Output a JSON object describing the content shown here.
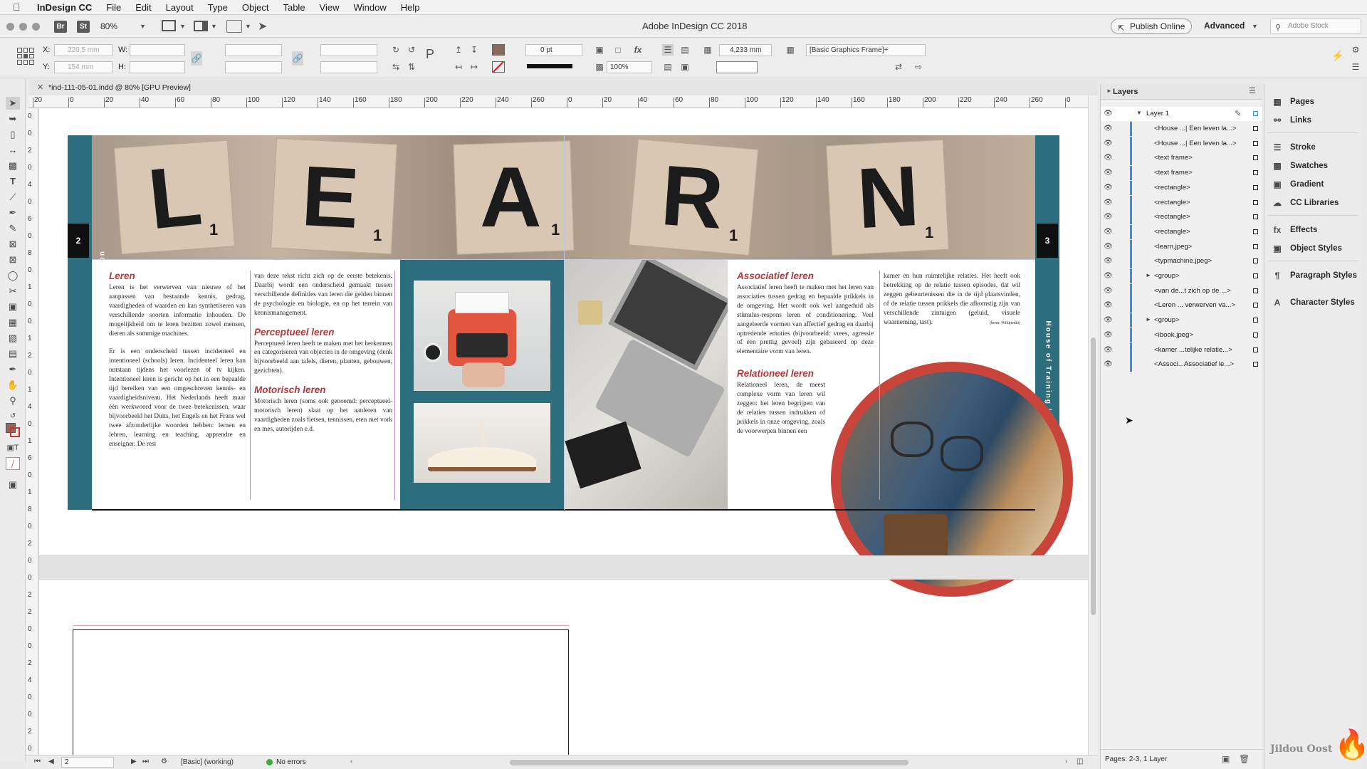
{
  "menubar": {
    "app": "InDesign CC",
    "items": [
      "File",
      "Edit",
      "Layout",
      "Type",
      "Object",
      "Table",
      "View",
      "Window",
      "Help"
    ]
  },
  "titlebar": {
    "title": "Adobe InDesign CC 2018",
    "zoom": "80%",
    "br_label": "Br",
    "st_label": "St",
    "publish": "Publish Online",
    "workspace": "Advanced",
    "search_placeholder": "Adobe Stock"
  },
  "control": {
    "x_label": "X:",
    "x_value": "220,5 mm",
    "y_label": "Y:",
    "y_value": "154 mm",
    "w_label": "W:",
    "h_label": "H:",
    "stroke_weight": "0 pt",
    "scale": "100%",
    "gap": "4,233 mm",
    "object_style": "[Basic Graphics Frame]+"
  },
  "doc_tab": {
    "title": "*ind-111-05-01.indd @ 80% [GPU Preview]"
  },
  "ruler": {
    "h_ticks": [
      "20",
      "0",
      "20",
      "40",
      "60",
      "80",
      "100",
      "120",
      "140",
      "160",
      "180",
      "200",
      "220",
      "240",
      "260",
      "0",
      "20",
      "40",
      "60",
      "80",
      "100",
      "120",
      "140",
      "160",
      "180",
      "200",
      "220",
      "240",
      "260",
      "0"
    ],
    "v_ticks": [
      "0",
      "0",
      "2",
      "0",
      "4",
      "0",
      "6",
      "0",
      "8",
      "0",
      "1",
      "0",
      "0",
      "1",
      "2",
      "0",
      "1",
      "4",
      "0",
      "1",
      "6",
      "0",
      "1",
      "8",
      "0",
      "2",
      "0",
      "0",
      "2",
      "2",
      "0",
      "0",
      "2",
      "4",
      "0",
      "0",
      "2",
      "0"
    ]
  },
  "spread": {
    "learn_letters": [
      "L",
      "E",
      "A",
      "R",
      "N"
    ],
    "learn_subs": [
      "1",
      "1",
      "1",
      "1",
      "1"
    ],
    "page_left": "2",
    "page_right": "3",
    "side_text": "House of Training | Een leven lang leren",
    "col1_head": "Leren",
    "col1_p1": "Leren is het verwerven van nieuwe of het aanpassen van bestaande kennis, gedrag, vaardigheden of waarden en kan synthetiseren van verschillende soorten informatie inhouden. De mogelijkheid om te leren bezitten zowel mensen, dieren als sommige machines.",
    "col1_p2": "Er is een onderscheid tussen incidenteel en intentioneel (schools) leren. Incidenteel leren kan ontstaan tijdens het voorlezen of tv kijken. Intentioneel leren is gericht op het in een bepaalde tijd bereiken van een omgeschreven kennis- en vaardigheidsniveau. Het Nederlands heeft maar één werkwoord voor de twee betekenissen, waar bijvoorbeeld het Duits, het Engels en het Frans wel twee afzonderlijke woorden hebben: lernen en lehren, learning en teaching, apprendre en enseigner. De rest",
    "col2_p1": "van deze tekst richt zich op de eerste betekenis. Daarbij wordt een onderscheid gemaakt tussen verschillende definities van leren die gelden binnen de psychologie en biologie, en op het terrein van kennismanagement.",
    "col2_head1": "Perceptueel leren",
    "col2_p2": "Perceptueel leren heeft te maken met het herkennen en categoriseren van objecten in de omgeving (denk bijvoorbeeld aan tafels, dieren, planten, gebouwen, gezichten).",
    "col2_head2": "Motorisch leren",
    "col2_p3": "Motorisch leren (soms ook genoemd: perceptueel-motorisch leren) slaat op het aanleren van vaardigheden zoals fietsen, tennissen, eten met vork en mes, autorijden e.d.",
    "col3_head1": "Associatief leren",
    "col3_p1": "Associatief leren heeft te maken met het leren van associaties tussen gedrag en bepaalde prikkels in de omgeving. Het wordt ook wel aangeduid als stimulus-respons leren of conditionering. Veel aangeleerde vormen van affectief gedrag en daarbij optredende emoties (bijvoorbeeld: vrees, agressie of een prettig gevoel) zijn gebaseerd op deze elementaire vorm van leren.",
    "col3_head2": "Relationeel leren",
    "col3_p2": "Relationeel leren, de meest complexe vorm van leren wil zeggen: het leren begrijpen van de relaties tussen indrukken of prikkels in onze omgeving, zoals de voorwerpen binnen een",
    "col4_p1": "kamer en hun ruimtelijke relaties. Het heeft ook betrekking op de relatie tussen episodes, dat wil zeggen gebeurtenissen die in de tijd plaatsvinden, of de relatie tussen prikkels die afkomstig zijn van verschillende zintuigen (geluid, visuele waarneming, tast).",
    "col4_source": "(bron: Wikipedia)"
  },
  "layers_panel": {
    "title": "Layers",
    "layer": "Layer 1",
    "items": [
      "<House ...| Een leven la...>",
      "<House ...| Een leven la...>",
      "<text frame>",
      "<text frame>",
      "<rectangle>",
      "<rectangle>",
      "<rectangle>",
      "<rectangle>",
      "<learn.jpeg>",
      "<typmachine.jpeg>",
      "<group>",
      "<van de...t zich op de ...>",
      "<Leren ... verwerven va...>",
      "<group>",
      "<ibook.jpeg>",
      "<kamer ...telijke relatie...>",
      "<Associ...Associatief le...>"
    ],
    "footer": "Pages: 2-3, 1 Layer"
  },
  "right_panels": {
    "items": [
      "Pages",
      "Links",
      "Stroke",
      "Swatches",
      "Gradient",
      "CC Libraries",
      "Effects",
      "Object Styles",
      "Paragraph Styles",
      "Character Styles"
    ],
    "icons": [
      "pages-icon",
      "links-icon",
      "stroke-icon",
      "swatches-icon",
      "gradient-icon",
      "cc-libraries-icon",
      "effects-icon",
      "object-styles-icon",
      "paragraph-styles-icon",
      "character-styles-icon"
    ]
  },
  "status": {
    "page": "2",
    "style": "[Basic] (working)",
    "errors": "No errors"
  },
  "watermark": "Jildou Oost",
  "colors": {
    "teal": "#2d6e7e",
    "red": "#c9453c",
    "heading": "#b33a3a"
  }
}
